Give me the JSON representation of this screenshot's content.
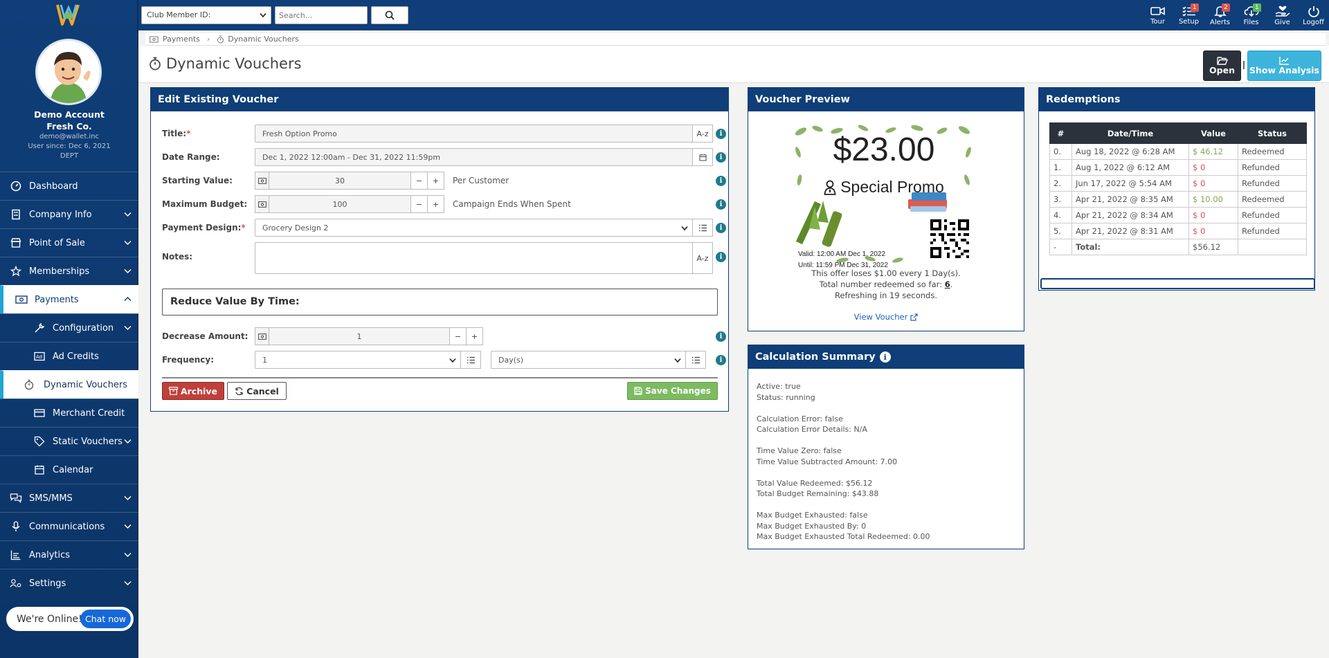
{
  "topbar": {
    "member_select": "Club Member ID:",
    "search_placeholder": "Search...",
    "icons": [
      {
        "name": "tour",
        "label": "Tour",
        "badge": null
      },
      {
        "name": "setup",
        "label": "Setup",
        "badge": "1",
        "badge_color": "red"
      },
      {
        "name": "alerts",
        "label": "Alerts",
        "badge": "2",
        "badge_color": "red"
      },
      {
        "name": "files",
        "label": "Files",
        "badge": "1",
        "badge_color": "green"
      },
      {
        "name": "give",
        "label": "Give",
        "badge": null
      },
      {
        "name": "logoff",
        "label": "Logoff",
        "badge": null
      }
    ]
  },
  "sidebar": {
    "account_name": "Demo Account",
    "company": "Fresh Co.",
    "email": "demo@wallet.inc",
    "user_since": "User since: Dec 6, 2021",
    "dept": "DEPT",
    "items": [
      {
        "label": "Dashboard",
        "icon": "dashboard-icon"
      },
      {
        "label": "Company Info",
        "icon": "building-icon"
      },
      {
        "label": "Point of Sale",
        "icon": "store-icon"
      },
      {
        "label": "Memberships",
        "icon": "star-icon"
      },
      {
        "label": "Payments",
        "icon": "money-icon"
      },
      {
        "label": "Configuration",
        "icon": "tools-icon"
      },
      {
        "label": "Ad Credits",
        "icon": "ad-icon"
      },
      {
        "label": "Dynamic Vouchers",
        "icon": "stopwatch-icon"
      },
      {
        "label": "Merchant Credit",
        "icon": "credit-card-icon"
      },
      {
        "label": "Static Vouchers",
        "icon": "tag-icon"
      },
      {
        "label": "Calendar",
        "icon": "calendar-icon"
      },
      {
        "label": "SMS/MMS",
        "icon": "chat-icon"
      },
      {
        "label": "Communications",
        "icon": "microphone-icon"
      },
      {
        "label": "Analytics",
        "icon": "chart-icon"
      },
      {
        "label": "Settings",
        "icon": "users-cog-icon"
      }
    ],
    "chat_text": "We're Online!",
    "chat_button": "Chat now"
  },
  "breadcrumb": {
    "parent": "Payments",
    "current": "Dynamic Vouchers"
  },
  "page_title": "Dynamic Vouchers",
  "actions": {
    "open": "Open",
    "analysis": "Show Analysis"
  },
  "edit": {
    "heading": "Edit Existing Voucher",
    "title_label": "Title:",
    "title_value": "Fresh Option Promo",
    "az": "A-z",
    "date_label": "Date Range:",
    "date_value": "Dec 1, 2022 12:00am - Dec 31, 2022 11:59pm",
    "start_label": "Starting Value:",
    "start_value": "30",
    "start_note": "Per Customer",
    "budget_label": "Maximum Budget:",
    "budget_value": "100",
    "budget_note": "Campaign Ends When Spent",
    "design_label": "Payment Design:",
    "design_value": "Grocery Design 2",
    "notes_label": "Notes:",
    "reduce_heading": "Reduce Value By Time:",
    "decrease_label": "Decrease Amount:",
    "decrease_value": "1",
    "frequency_label": "Frequency:",
    "frequency_value": "1",
    "frequency_unit": "Day(s)",
    "archive": "Archive",
    "cancel": "Cancel",
    "save": "Save Changes"
  },
  "preview": {
    "heading": "Voucher Preview",
    "amount": "$23.00",
    "promo": "Special Promo",
    "valid_from": "Valid: 12:00 AM Dec 1, 2022",
    "valid_until": "Until: 11:59 PM Dec 31, 2022",
    "offer_text": "This offer loses $1.00 every 1 Day(s).",
    "redeemed_text": "Total number redeemed so far:",
    "redeemed_count": "6",
    "refresh_text": "Refreshing in 19 seconds.",
    "link": "View Voucher"
  },
  "calc": {
    "heading": "Calculation Summary",
    "lines": [
      "Active: true",
      "Status: running",
      "",
      "Calculation Error: false",
      "Calculation Error Details: N/A",
      "",
      "Time Value Zero: false",
      "Time Value Subtracted Amount: 7.00",
      "",
      "Total Value Redeemed: $56.12",
      "Total Budget Remaining: $43.88",
      "",
      "Max Budget Exhausted: false",
      "Max Budget Exhausted By: 0",
      "Max Budget Exhausted Total Redeemed: 0.00"
    ]
  },
  "redemptions": {
    "heading": "Redemptions",
    "columns": [
      "#",
      "Date/Time",
      "Value",
      "Status"
    ],
    "rows": [
      {
        "n": "0.",
        "date": "Aug 18, 2022 @ 6:28 AM",
        "value": "$ 46.12",
        "status": "Redeemed",
        "color": "green"
      },
      {
        "n": "1.",
        "date": "Aug 1, 2022 @ 6:12 AM",
        "value": "$ 0",
        "status": "Refunded",
        "color": "red"
      },
      {
        "n": "2.",
        "date": "Jun 17, 2022 @ 5:54 AM",
        "value": "$ 0",
        "status": "Refunded",
        "color": "red"
      },
      {
        "n": "3.",
        "date": "Apr 21, 2022 @ 8:35 AM",
        "value": "$ 10.00",
        "status": "Redeemed",
        "color": "green"
      },
      {
        "n": "4.",
        "date": "Apr 21, 2022 @ 8:34 AM",
        "value": "$ 0",
        "status": "Refunded",
        "color": "red"
      },
      {
        "n": "5.",
        "date": "Apr 21, 2022 @ 8:31 AM",
        "value": "$ 0",
        "status": "Refunded",
        "color": "red"
      }
    ],
    "total_n": "-",
    "total_label": "Total:",
    "total_value": "$56.12"
  }
}
